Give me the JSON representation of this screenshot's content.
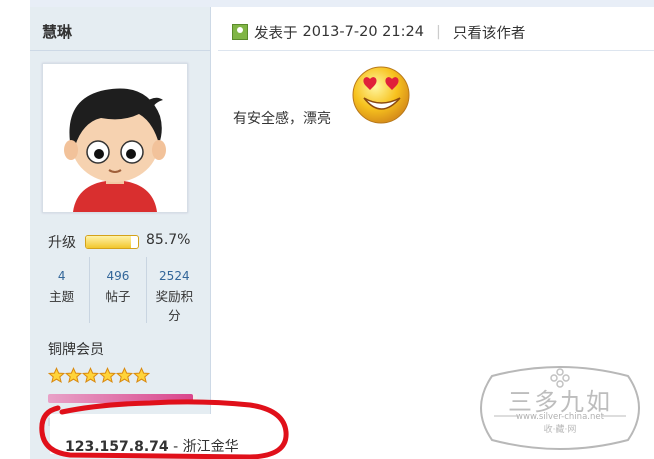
{
  "user": {
    "name": "慧琳",
    "progress_label": "升级",
    "progress_value": "85.7%",
    "progress_fraction": 0.857,
    "stats": [
      {
        "value": "4",
        "label": "主题"
      },
      {
        "value": "496",
        "label": "帖子"
      },
      {
        "value": "2524",
        "label": "奖励积分"
      }
    ],
    "rank": "铜牌会员",
    "stars_count": 6,
    "ip": "123.157.8.74",
    "ip_separator": " - ",
    "location": "浙江金华"
  },
  "post": {
    "posted_prefix": "发表于",
    "datetime": "2013-7-20 21:24",
    "only_author_link": "只看该作者",
    "content": "有安全感，漂亮",
    "emoji": "love-smiley-icon"
  },
  "watermark": {
    "brand": "三多九如",
    "url": "www.silver-china.net",
    "tagline": "收·藏·网"
  },
  "colors": {
    "sidebar_bg": "#e5edf2",
    "link_blue": "#336699",
    "progress_gold": "#f2c72d",
    "credit_pink": "#d9468c",
    "annotation_red": "#e0101a"
  }
}
